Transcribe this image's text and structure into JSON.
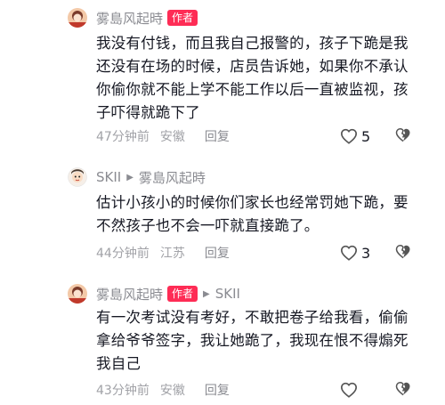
{
  "comments": [
    {
      "username": "雾島风起時",
      "badge": "作者",
      "reply_to": "",
      "text": "我没有付钱，而且我自己报警的，孩子下跪是我还没有在场的时候，店员告诉她，如果你不承认你偷你就不能上学不能工作以后一直被监视，孩子吓得就跪下了",
      "time": "47分钟前",
      "location": "安徽",
      "reply_label": "回复",
      "likes": "5"
    },
    {
      "username": "SKII",
      "badge": "",
      "reply_to": "雾島风起時",
      "text": "估计小孩小的时候你们家长也经常罚她下跪，要不然孩子也不会一吓就直接跪了。",
      "time": "44分钟前",
      "location": "江苏",
      "reply_label": "回复",
      "likes": "3"
    },
    {
      "username": "雾島风起時",
      "badge": "作者",
      "reply_to": "SKII",
      "text": "有一次考试没有考好，不敢把卷子给我看，偷偷拿给爷爷签字，我让她跪了，我现在恨不得煽死我自己",
      "time": "43分钟前",
      "location": "安徽",
      "reply_label": "回复",
      "likes": ""
    }
  ],
  "colors": {
    "accent": "#fe2c55",
    "muted": "#8a8b91",
    "text": "#161823"
  },
  "icons": {
    "reply_arrow": "caret-right-icon",
    "like": "heart-outline-icon",
    "dislike": "broken-heart-icon"
  }
}
